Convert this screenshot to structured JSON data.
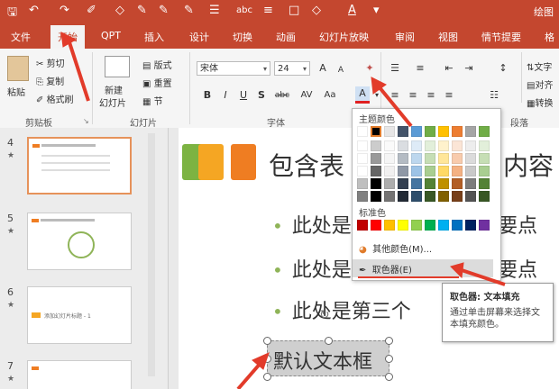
{
  "window": {
    "title_right": "绘图"
  },
  "quick_access": [
    "save-icon",
    "undo-icon",
    "redo-icon",
    "brush-icon",
    "pen-icon",
    "pen-icon",
    "pen-icon",
    "list-icon",
    "abc",
    "align-icon",
    "shape-icon",
    "font-color-icon",
    "more-icon"
  ],
  "quick_access_abc": "abc",
  "tabs": [
    "文件",
    "开始",
    "QPT",
    "插入",
    "设计",
    "切换",
    "动画",
    "幻灯片放映",
    "审阅",
    "视图",
    "情节提要",
    "格"
  ],
  "ribbon": {
    "clipboard": {
      "label": "剪贴板",
      "paste": "粘贴",
      "cut": "剪切",
      "copy": "复制",
      "format_painter": "格式刷"
    },
    "slides": {
      "label": "幻灯片",
      "new_slide": "新建",
      "new_slide_2": "幻灯片",
      "layout": "版式",
      "reset": "重置",
      "section": "节"
    },
    "font": {
      "label": "字体",
      "font_name": "宋体",
      "font_size": "24",
      "grow": "A",
      "shrink": "A",
      "bold": "B",
      "italic": "I",
      "underline": "U",
      "shadow": "S",
      "strike": "abc",
      "spacing": "AV",
      "case": "Aa",
      "font_color": "A"
    },
    "paragraph": {
      "label": "段落"
    },
    "text_dir": "文字",
    "align_text": "对齐",
    "convert": "转换"
  },
  "slides": [
    {
      "num": "4",
      "star": "★",
      "selected": true
    },
    {
      "num": "5",
      "star": "★",
      "selected": false
    },
    {
      "num": "6",
      "star": "★",
      "selected": false,
      "caption": "添加幻灯片标题 - 1"
    },
    {
      "num": "7",
      "star": "★",
      "selected": false
    }
  ],
  "slide": {
    "title": "包含表",
    "title_tail": "内容",
    "bullets": [
      "此处是",
      "此处是",
      "此处是第三个"
    ],
    "bullet_tails": [
      "要点",
      "要点",
      ""
    ],
    "textbox": "默认文本框",
    "squares": [
      "#7cb342",
      "#f5a623",
      "#ef7d22"
    ]
  },
  "color_menu": {
    "theme_colors_label": "主题颜色",
    "standard_colors_label": "标准色",
    "more_colors": "其他颜色(M)...",
    "eyedropper": "取色器(E)",
    "theme_row": [
      "#ffffff",
      "#000000",
      "#e7e6e6",
      "#44546a",
      "#5b9bd5",
      "#70ad47",
      "#ffc000",
      "#ed7d31",
      "#a5a5a5",
      "#70ad47"
    ],
    "standard_row": [
      "#c00000",
      "#ff0000",
      "#ffc000",
      "#ffff00",
      "#92d050",
      "#00b050",
      "#00b0f0",
      "#0070c0",
      "#002060",
      "#7030a0"
    ]
  },
  "tooltip": {
    "title": "取色器: 文本填充",
    "body": "通过单击屏幕来选择文本填充颜色。"
  }
}
